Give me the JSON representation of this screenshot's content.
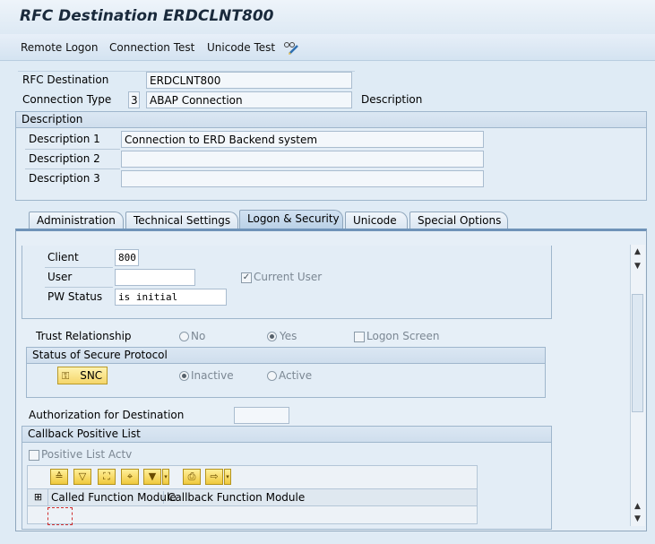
{
  "window": {
    "title": "RFC Destination ERDCLNT800"
  },
  "toolbar": {
    "remote_logon": "Remote Logon",
    "connection_test": "Connection Test",
    "unicode_test": "Unicode Test"
  },
  "header": {
    "rfc_destination_label": "RFC Destination",
    "rfc_destination_value": "ERDCLNT800",
    "connection_type_label": "Connection Type",
    "connection_type_code": "3",
    "connection_type_value": "ABAP Connection",
    "description_label": "Description"
  },
  "description_group": {
    "title": "Description",
    "rows": [
      {
        "label": "Description 1",
        "value": "Connection to ERD Backend system"
      },
      {
        "label": "Description 2",
        "value": ""
      },
      {
        "label": "Description 3",
        "value": ""
      }
    ]
  },
  "tabs": [
    "Administration",
    "Technical Settings",
    "Logon & Security",
    "Unicode",
    "Special Options"
  ],
  "active_tab": "Logon & Security",
  "logon": {
    "client_label": "Client",
    "client_value": "800",
    "user_label": "User",
    "user_value": "",
    "current_user_label": "Current User",
    "current_user_checked": true,
    "pw_status_label": "PW Status",
    "pw_status_value": "is initial"
  },
  "trust": {
    "label": "Trust Relationship",
    "no": "No",
    "yes": "Yes",
    "selected": "Yes",
    "logon_screen": "Logon Screen"
  },
  "secure_protocol": {
    "title": "Status of Secure Protocol",
    "snc_button": "SNC",
    "inactive": "Inactive",
    "active": "Active",
    "selected": "Inactive"
  },
  "authorization": {
    "label": "Authorization for Destination",
    "value": ""
  },
  "callback": {
    "title": "Callback Positive List",
    "positive_list_label": "Positive List Actv",
    "positive_list_checked": false,
    "columns": [
      "Called Function Module",
      "Callback Function Module"
    ]
  },
  "colors": {
    "background": "#dfebf5",
    "tab_active": "#b9d0e6",
    "button_yellow": "#f5d66a"
  }
}
